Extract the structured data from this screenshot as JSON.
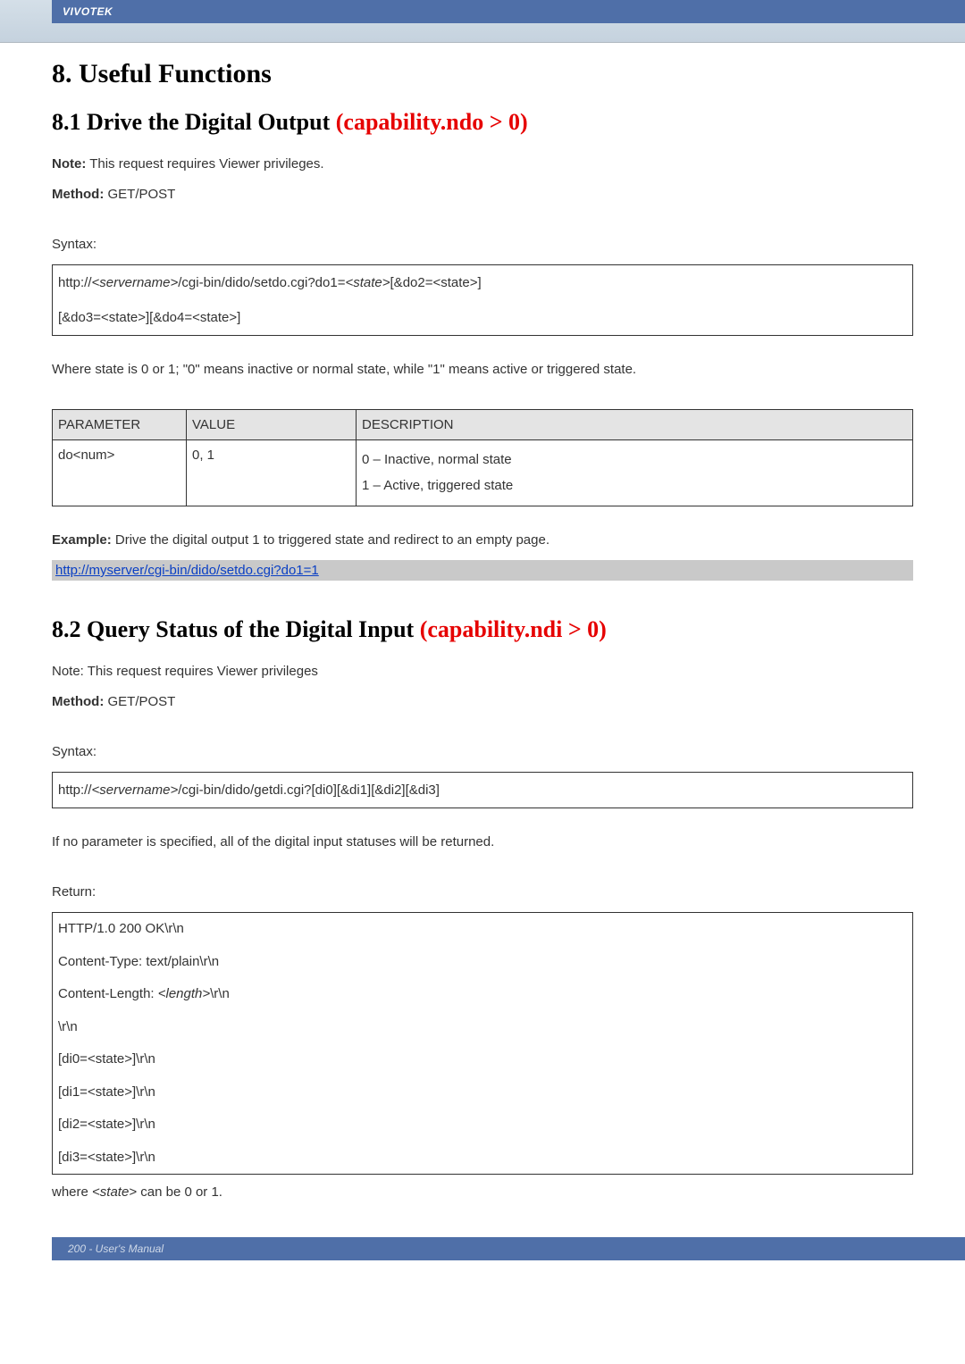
{
  "header": {
    "brand": "VIVOTEK"
  },
  "h1": "8. Useful Functions",
  "s81": {
    "title_black": "8.1 Drive the Digital Output ",
    "title_red": "(capability.ndo > 0)",
    "note_label": "Note:",
    "note_text": " This request requires Viewer privileges.",
    "method_label": "Method:",
    "method_text": " GET/POST",
    "syntax_label": "Syntax:",
    "syntax_line1_a": "http://",
    "syntax_line1_b": "<servername>",
    "syntax_line1_c": "/cgi-bin/dido/setdo.cgi?do1=",
    "syntax_line1_d": "<state>",
    "syntax_line1_e": "[&do2=<state>]",
    "syntax_line2": "[&do3=<state>][&do4=<state>]",
    "state_desc": "Where state is 0 or 1; \"0\" means inactive or normal state, while \"1\" means active or triggered state.",
    "table": {
      "h1": "PARAMETER",
      "h2": "VALUE",
      "h3": "DESCRIPTION",
      "r1c1": "do<num>",
      "r1c2": "0, 1",
      "r1c3a": "0 – Inactive, normal state",
      "r1c3b": "1 – Active, triggered state"
    },
    "example_label": "Example:",
    "example_text": " Drive the digital output 1 to triggered state and redirect to an empty page.",
    "example_url": "http://myserver/cgi-bin/dido/setdo.cgi?do1=1"
  },
  "s82": {
    "title_black": "8.2 Query Status of the Digital Input ",
    "title_red": "(capability.ndi > 0)",
    "note_text": "Note: This request requires Viewer privileges",
    "method_label": "Method:",
    "method_text": " GET/POST",
    "syntax_label": "Syntax:",
    "syntax_line1_a": "http://",
    "syntax_line1_b": "<servername>",
    "syntax_line1_c": "/cgi-bin/dido/getdi.cgi?[di0][&di1][&di2][&di3]",
    "noparam": "If no parameter is specified, all of the digital input statuses will be returned.",
    "return_label": "Return:",
    "ret_lines": {
      "l1": "HTTP/1.0 200 OK\\r\\n",
      "l2": "Content-Type: text/plain\\r\\n",
      "l3a": "Content-Length: ",
      "l3b": "<length>",
      "l3c": "\\r\\n",
      "l4": "\\r\\n",
      "l5": "[di0=<state>]\\r\\n",
      "l6": "[di1=<state>]\\r\\n",
      "l7": "[di2=<state>]\\r\\n",
      "l8": "[di3=<state>]\\r\\n"
    },
    "where_a": "where ",
    "where_b": "<state>",
    "where_c": " can be 0 or 1."
  },
  "footer": "200 - User's Manual"
}
